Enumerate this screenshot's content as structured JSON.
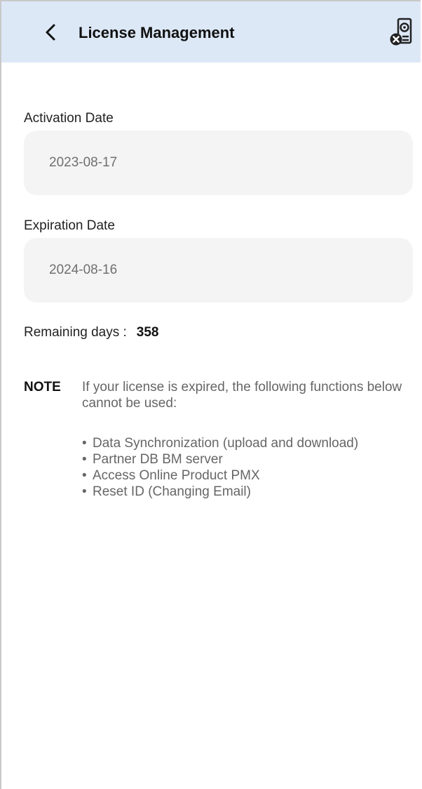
{
  "header": {
    "title": "License Management",
    "back_icon": "chevron-left-icon",
    "action_icon": "license-status-icon"
  },
  "activation": {
    "label": "Activation Date",
    "value": "2023-08-17"
  },
  "expiration": {
    "label": "Expiration Date",
    "value": "2024-08-16"
  },
  "remaining": {
    "label": "Remaining days :",
    "value": "358"
  },
  "note": {
    "label": "NOTE",
    "text": "If your license is expired, the following functions below cannot be used:",
    "bullet_symbol": "•",
    "items": [
      "Data Synchronization (upload and download)",
      "Partner DB BM server",
      "Access Online Product PMX",
      "Reset ID (Changing Email)"
    ]
  },
  "colors": {
    "app_bar": "#dde8f7",
    "field_background": "#f4f4f4",
    "value_text": "#6f6f6f",
    "note_text": "#666666"
  }
}
